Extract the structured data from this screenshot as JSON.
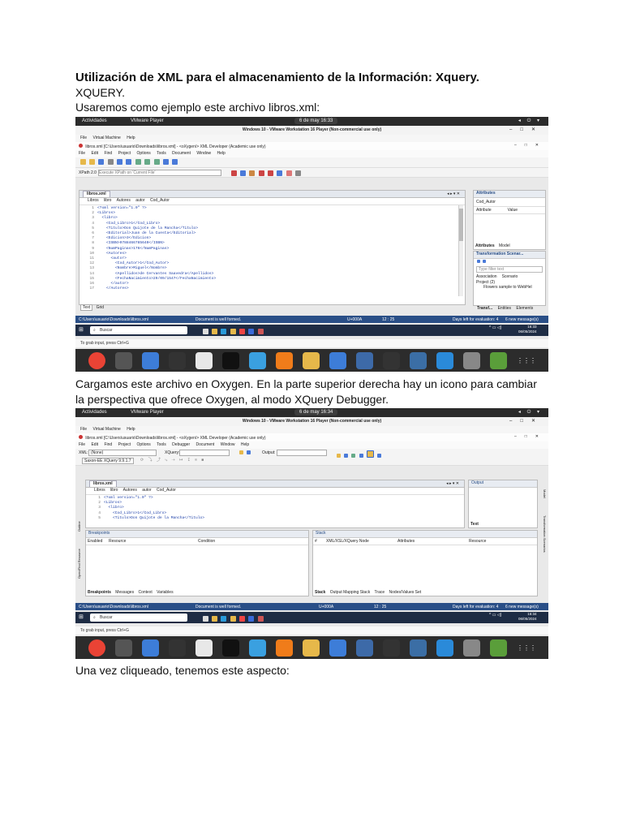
{
  "document": {
    "title": "Utilización de XML para el almacenamiento de la Información: Xquery.",
    "subtitle": "XQUERY.",
    "intro": "Usaremos como ejemplo este archivo libros.xml:",
    "para1_line1": "Cargamos este archivo en Oxygen. En la parte superior derecha hay un icono para cambiar",
    "para1_line2": "la perspectiva que ofrece Oxygen, al modo XQuery Debugger.",
    "para2": "Una vez cliqueado, tenemos este aspecto:"
  },
  "shot1": {
    "activities": "Actividades",
    "vmware_player": "VMware Player",
    "date": "6 de may  16:33",
    "vm_title": "Windows 10 - VMware Workstation 16 Player (Non-commercial use only)",
    "vm_menu": [
      "File",
      "Virtual Machine",
      "Help"
    ],
    "ox_title": "libros.xml [C:\\Users\\usuario\\Downloads\\libros.xml] - <oXygen/> XML Developer (Academic use only)",
    "ox_menu": [
      "File",
      "Edit",
      "Find",
      "Project",
      "Options",
      "Tools",
      "Document",
      "Window",
      "Help"
    ],
    "xpath": "XPath 2.0",
    "xpath_placeholder": "Execute XPath on 'Current File'",
    "tab": "libros.xml",
    "breadcrumb": [
      "Libros",
      "libro",
      "Autores",
      "autor",
      "Cod_Autor"
    ],
    "code": [
      {
        "n": "1",
        "t": "<?xml version=\"1.0\" ?>"
      },
      {
        "n": "2",
        "t": "<Libros>"
      },
      {
        "n": "3",
        "t": "  <libro>"
      },
      {
        "n": "4",
        "t": "    <Cod_Libro>1</Cod_Libro>"
      },
      {
        "n": "5",
        "t": "    <Titulo>Don Quijote de la Mancha</Titulo>"
      },
      {
        "n": "6",
        "t": "    <Editorial>Juan de la Cuesta</Editorial>"
      },
      {
        "n": "7",
        "t": "    <Edicion>3</Edicion>"
      },
      {
        "n": "8",
        "t": "    <ISBN>9788466785640</ISBN>"
      },
      {
        "n": "9",
        "t": "    <NumPaginas>176</NumPaginas>"
      },
      {
        "n": "10",
        "t": "    <Autores>"
      },
      {
        "n": "11",
        "t": "      <autor>"
      },
      {
        "n": "12",
        "t": "        <Cod_Autor>1</Cod_Autor>"
      },
      {
        "n": "13",
        "t": "        <Nombre>Miguel</Nombre>"
      },
      {
        "n": "14",
        "t": "        <Apellidos>de Cervantes Saavedra</Apellidos>"
      },
      {
        "n": "15",
        "t": "        <FechaNacimiento>29/09/1547</FechaNacimiento>"
      },
      {
        "n": "16",
        "t": "      </autor>"
      },
      {
        "n": "17",
        "t": "    </Autores>"
      }
    ],
    "bottom_tabs": [
      "Text",
      "Grid"
    ],
    "attributes_title": "Attributes",
    "attributes_element": "Cod_Autor",
    "attributes_cols": [
      "Attribute",
      "Value"
    ],
    "attr_tabs": [
      "Attributes",
      "Model"
    ],
    "scenarios_title": "Transformation Scenar...",
    "scenarios_filter": "Type filter text",
    "scenarios_cols": [
      "Association",
      "Scenario"
    ],
    "scenarios_project": "Project (2)",
    "scenarios_item": "Flowers sample to WebHel",
    "right_tabs": [
      "Transf...",
      "Entities",
      "Elements"
    ],
    "status_path": "C:\\Users\\usuario\\Downloads\\libros.xml",
    "status_msg": "Document is well formed.",
    "status_enc": "U+000A",
    "status_pos": "12 : 25",
    "status_eval": "Days left for evaluation: 4",
    "status_new": "6 new message(s)",
    "taskbar_search": "Buscar",
    "clock_time": "16:33",
    "clock_date": "06/05/2024",
    "grab": "To grab input, press Ctrl+G"
  },
  "shot2": {
    "activities": "Actividades",
    "vmware_player": "VMware Player",
    "date": "6 de may  16:34",
    "vm_title": "Windows 10 - VMware Workstation 16 Player (Non-commercial use only)",
    "vm_menu": [
      "File",
      "Virtual Machine",
      "Help"
    ],
    "ox_title": "libros.xml [C:\\Users\\usuario\\Downloads\\libros.xml] - <oXygen/> XML Developer (Academic use only)",
    "ox_menu": [
      "File",
      "Edit",
      "Find",
      "Project",
      "Options",
      "Tools",
      "Debugger",
      "Document",
      "Window",
      "Help"
    ],
    "xml_label": "XML:",
    "xml_value": "(None)",
    "xquery_label": "XQuery:",
    "output_label": "Output:",
    "engine": "Saxon-EE XQuery 9.9.1.7",
    "tab": "libros.xml",
    "breadcrumb": [
      "Libros",
      "libro",
      "Autores",
      "autor",
      "Cod_Autor"
    ],
    "code": [
      {
        "n": "1",
        "t": "<?xml version=\"1.0\" ?>"
      },
      {
        "n": "2",
        "t": "<Libros>"
      },
      {
        "n": "3",
        "t": "  <libro>"
      },
      {
        "n": "4",
        "t": "    <Cod_Libro>1</Cod_Libro>"
      },
      {
        "n": "5",
        "t": "    <Titulo>Don Quijote de la Mancha</Titulo>"
      }
    ],
    "output_title": "Output",
    "text_label": "Text",
    "breakpoints_title": "Breakpoints",
    "breakpoints_cols": [
      "Enabled",
      "Resource",
      "Condition"
    ],
    "stack_title": "Stack",
    "stack_cols": [
      "#",
      "XML/XSL/XQuery Node",
      "Attributes",
      "Resource"
    ],
    "left_tabs": [
      "Breakpoints",
      "Messages",
      "Context",
      "Variables"
    ],
    "right_tabs": [
      "Stack",
      "Output Mapping Stack",
      "Trace",
      "Nodes/Values Set"
    ],
    "side_left": [
      "Open/Find Resource",
      "Outline"
    ],
    "side_right": [
      "Model",
      "Transformation Scenarios"
    ],
    "status_path": "C:\\Users\\usuario\\Downloads\\libros.xml",
    "status_msg": "Document is well formed.",
    "status_enc": "U+000A",
    "status_pos": "12 : 25",
    "status_eval": "Days left for evaluation: 4",
    "status_new": "6 new message(s)",
    "taskbar_search": "Buscar",
    "clock_time": "16:34",
    "clock_date": "06/05/2024",
    "grab": "To grab input, press Ctrl+G"
  },
  "colors": {
    "status_bar": "#2a4f87",
    "taskbar": "#1e2c44",
    "dock": "#2c2c2c",
    "xml_tag": "#1a3da8"
  },
  "dock_icons": [
    "chrome-icon",
    "files-icon",
    "text-editor-icon",
    "terminal-icon",
    "wireshark-icon",
    "inkscape-icon",
    "network-icon",
    "blender-icon",
    "vmware-icon",
    "monitor-icon",
    "filezilla-icon",
    "terminal-icon",
    "virtualbox-icon",
    "vscode-icon",
    "disk-icon",
    "trash-icon",
    "apps-grid-icon"
  ]
}
